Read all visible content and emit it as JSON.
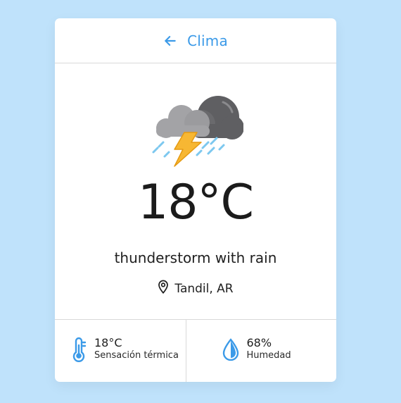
{
  "header": {
    "title": "Clima",
    "back_icon": "arrow-left-icon"
  },
  "weather": {
    "icon": "thunderstorm-rain-icon",
    "temperature": "18°C",
    "description": "thunderstorm with rain",
    "location": "Tandil, AR",
    "location_icon": "map-pin-icon"
  },
  "stats": {
    "feels_like": {
      "value": "18°C",
      "label": "Sensación térmica",
      "icon": "thermometer-icon"
    },
    "humidity": {
      "value": "68%",
      "label": "Humedad",
      "icon": "water-drop-icon"
    }
  },
  "colors": {
    "background": "#bfe2fb",
    "accent": "#3b9ae8",
    "card": "#ffffff"
  }
}
